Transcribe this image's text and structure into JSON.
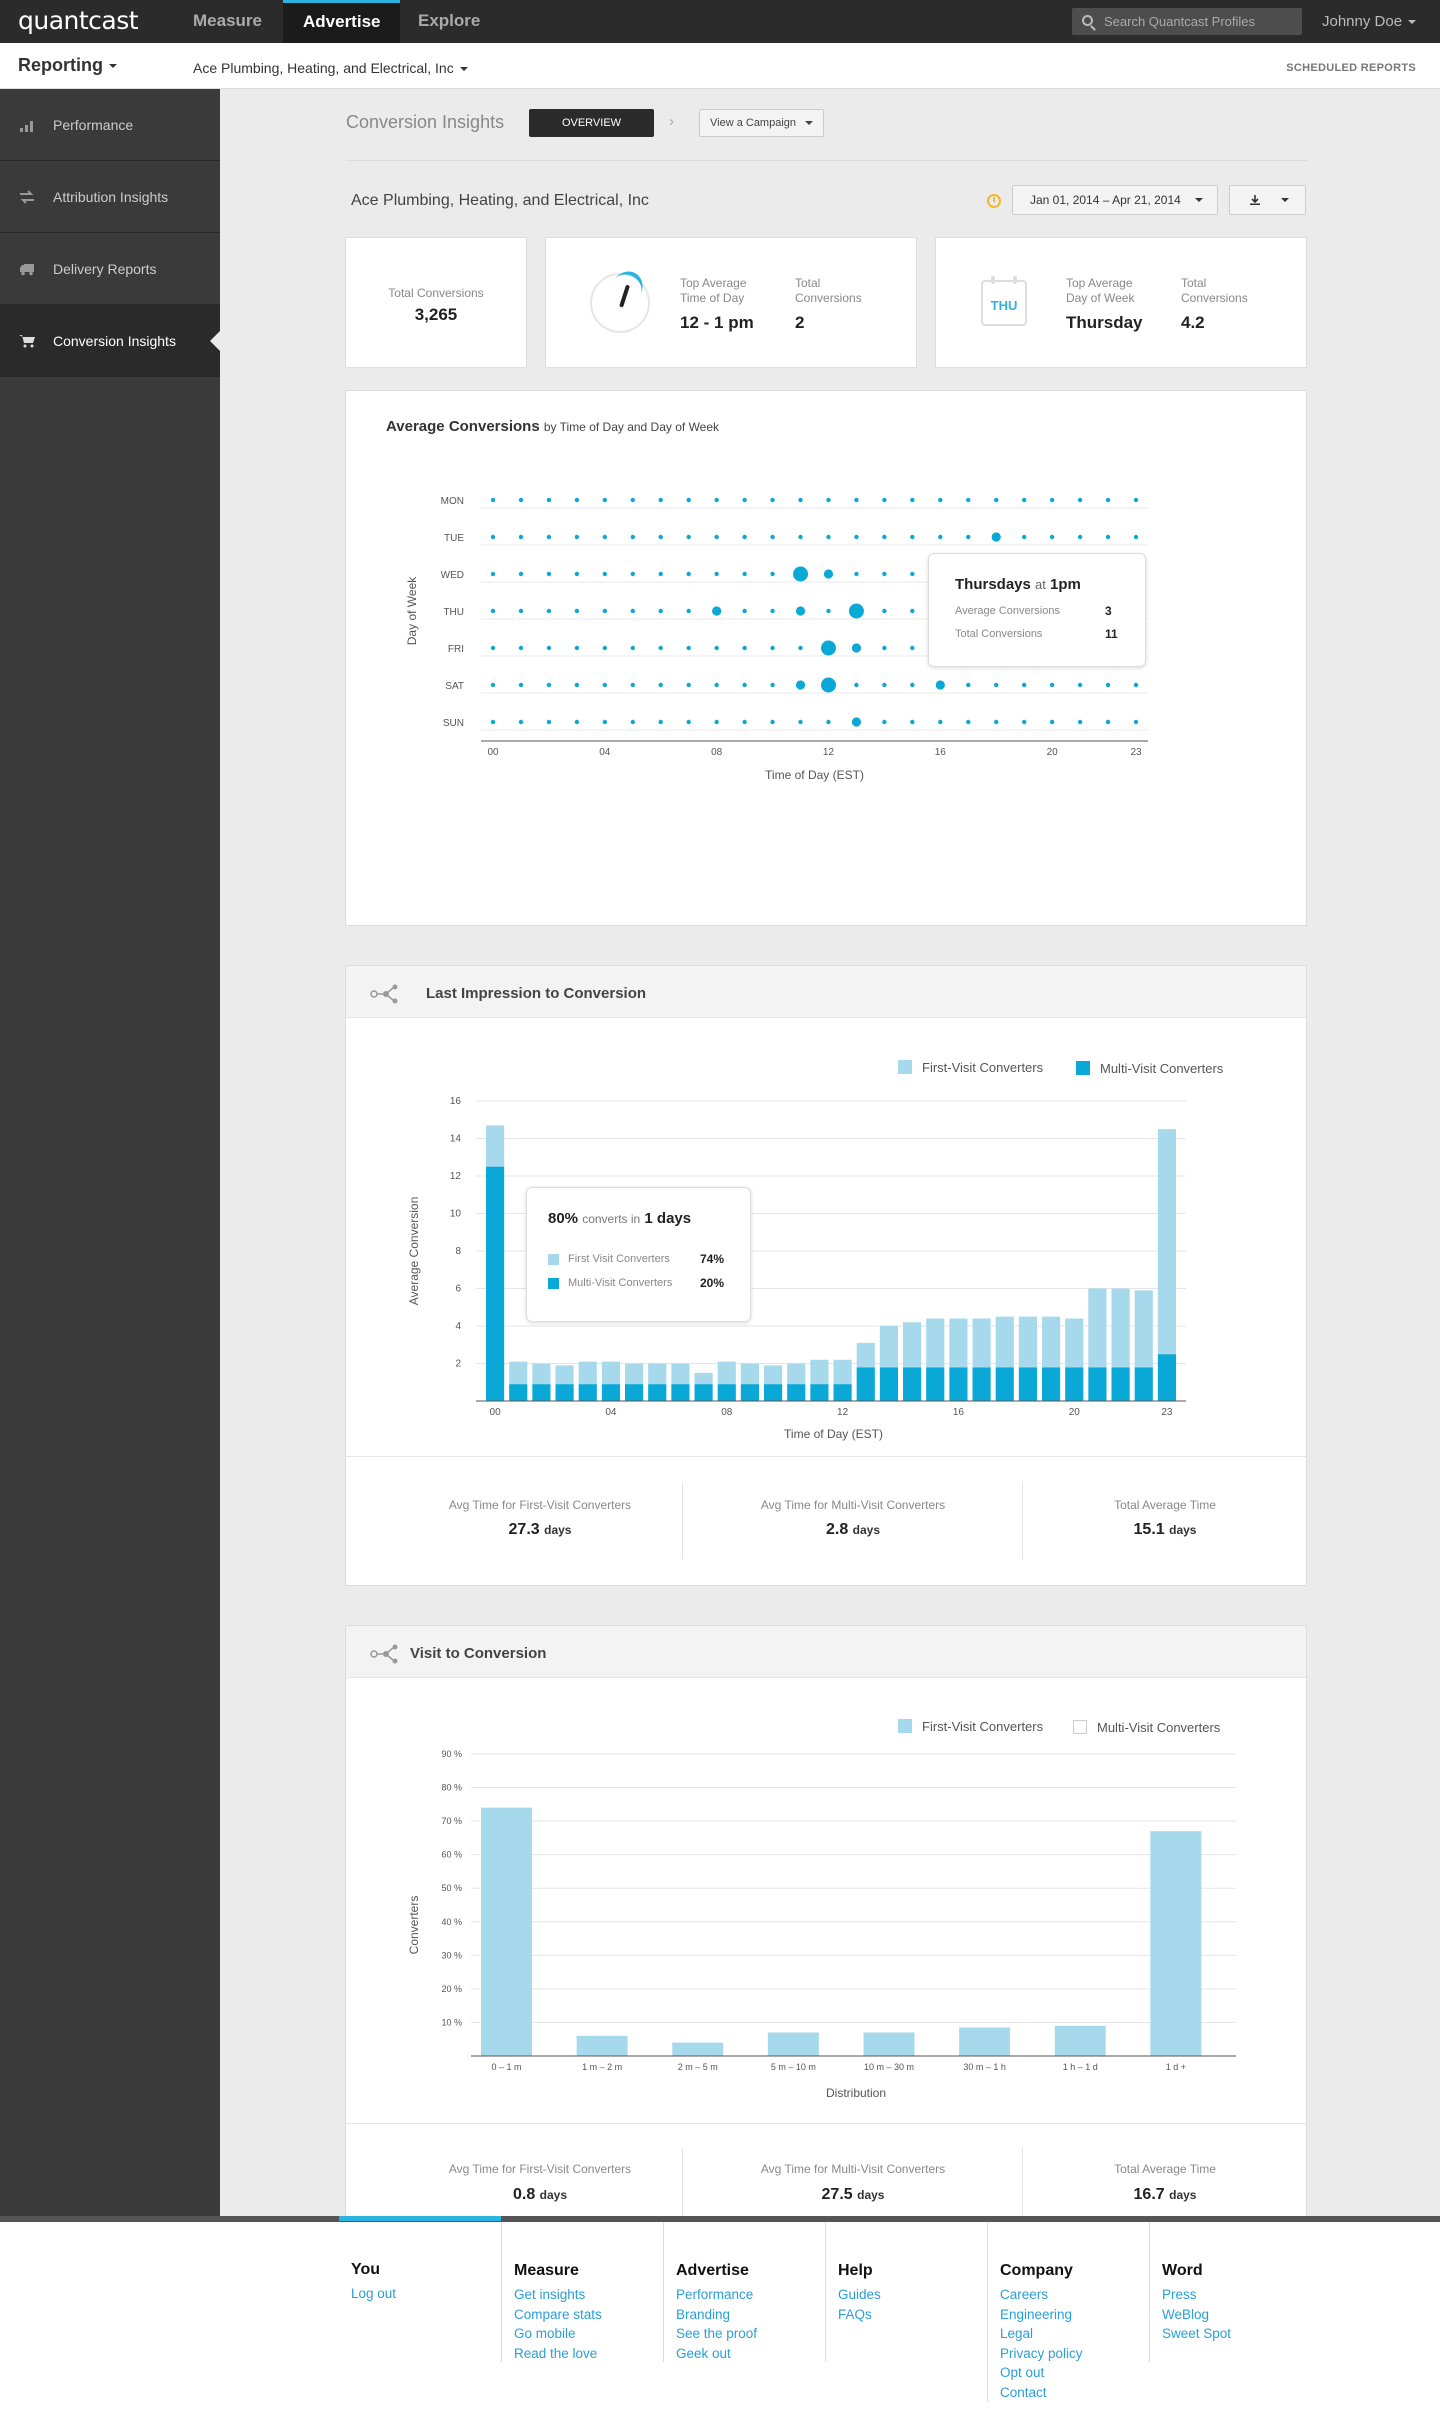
{
  "header": {
    "logo": "quantcast",
    "tabs": [
      {
        "label": "Measure",
        "active": false
      },
      {
        "label": "Advertise",
        "active": true
      },
      {
        "label": "Explore",
        "active": false
      }
    ],
    "search_placeholder": "Search Quantcast Profiles",
    "user": "Johnny Doe",
    "accent_color": "#2cb3e0"
  },
  "subheader": {
    "section": "Reporting",
    "company": "Ace Plumbing, Heating, and Electrical, Inc",
    "scheduled_reports": "SCHEDULED REPORTS"
  },
  "sidebar": {
    "items": [
      {
        "label": "Performance",
        "icon": "bar-chart-icon",
        "active": false
      },
      {
        "label": "Attribution Insights",
        "icon": "swap-arrows-icon",
        "active": false
      },
      {
        "label": "Delivery Reports",
        "icon": "truck-icon",
        "active": false
      },
      {
        "label": "Conversion Insights",
        "icon": "cart-icon",
        "active": true
      }
    ]
  },
  "page": {
    "title": "Conversion Insights",
    "overview_button": "OVERVIEW",
    "campaign_select": "View a Campaign",
    "company": "Ace Plumbing, Heating, and Electrical, Inc",
    "date_range": "Jan 01, 2014 – Apr 21, 2014"
  },
  "kpis": {
    "total_conversions_label": "Total Conversions",
    "total_conversions_value": "3,265",
    "top_time_label": "Top Average Time of Day",
    "top_time_value": "12 - 1 pm",
    "time_total_label": "Total Conversions",
    "time_total_value": "2",
    "calendar_day": "THU",
    "top_day_label": "Top Average Day of Week",
    "top_day_value": "Thursday",
    "day_total_label": "Total Conversions",
    "day_total_value": "4.2"
  },
  "avg_conversions": {
    "title": "Average Conversions",
    "subtitle": "by Time of Day and Day of Week",
    "tooltip": {
      "day": "Thursdays",
      "at": "at",
      "time": "1pm",
      "avg_label": "Average Conversions",
      "avg_value": "3",
      "total_label": "Total Conversions",
      "total_value": "11"
    }
  },
  "last_impression": {
    "title": "Last Impression to Conversion",
    "legend": [
      "First-Visit Converters",
      "Multi-Visit Converters"
    ],
    "tooltip": {
      "pct": "80%",
      "mid": "converts in",
      "days": "1 days",
      "first_label": "First Visit Converters",
      "first_value": "74%",
      "multi_label": "Multi-Visit Converters",
      "multi_value": "20%"
    },
    "stats": [
      {
        "label": "Avg Time for First-Visit Converters",
        "value": "27.3",
        "unit": "days"
      },
      {
        "label": "Avg Time for Multi-Visit Converters",
        "value": "2.8",
        "unit": "days"
      },
      {
        "label": "Total Average Time",
        "value": "15.1",
        "unit": "days"
      }
    ]
  },
  "visit_to_conversion": {
    "title": "Visit to Conversion",
    "legend": [
      "First-Visit Converters",
      "Multi-Visit Converters"
    ],
    "stats": [
      {
        "label": "Avg Time for First-Visit Converters",
        "value": "0.8",
        "unit": "days"
      },
      {
        "label": "Avg Time for Multi-Visit Converters",
        "value": "27.5",
        "unit": "days"
      },
      {
        "label": "Total Average Time",
        "value": "16.7",
        "unit": "days"
      }
    ]
  },
  "chart_data": [
    {
      "type": "scatter",
      "title": "Average Conversions",
      "subtitle": "by Time of Day and Day of Week",
      "xlabel": "Time of Day (EST)",
      "ylabel": "Day of Week",
      "days": [
        "MON",
        "TUE",
        "WED",
        "THU",
        "FRI",
        "SAT",
        "SUN"
      ],
      "x_ticks": [
        "00",
        "04",
        "08",
        "12",
        "16",
        "20",
        "23"
      ],
      "hours": 24,
      "base_size": 1,
      "highlights": [
        {
          "day": "TUE",
          "hour": 18,
          "size": 2
        },
        {
          "day": "WED",
          "hour": 11,
          "size": 3
        },
        {
          "day": "WED",
          "hour": 12,
          "size": 2
        },
        {
          "day": "THU",
          "hour": 8,
          "size": 2
        },
        {
          "day": "THU",
          "hour": 11,
          "size": 2
        },
        {
          "day": "THU",
          "hour": 13,
          "size": 3
        },
        {
          "day": "FRI",
          "hour": 12,
          "size": 3
        },
        {
          "day": "FRI",
          "hour": 13,
          "size": 2
        },
        {
          "day": "SAT",
          "hour": 11,
          "size": 2
        },
        {
          "day": "SAT",
          "hour": 12,
          "size": 3
        },
        {
          "day": "SAT",
          "hour": 16,
          "size": 2
        },
        {
          "day": "SUN",
          "hour": 13,
          "size": 2
        }
      ]
    },
    {
      "type": "bar",
      "stacked": true,
      "xlabel": "Time of Day (EST)",
      "ylabel": "Average Conversion",
      "ylim": [
        0,
        16
      ],
      "y_ticks": [
        2,
        4,
        6,
        8,
        10,
        12,
        14,
        16
      ],
      "x_ticks": [
        "00",
        "04",
        "08",
        "12",
        "16",
        "20",
        "23"
      ],
      "series": [
        {
          "name": "Multi-Visit Converters",
          "color": "#0aa8d6",
          "values": [
            12.5,
            0.9,
            0.9,
            0.9,
            0.9,
            0.9,
            0.9,
            0.9,
            0.9,
            0.9,
            0.9,
            0.9,
            0.9,
            0.9,
            0.9,
            0.9,
            1.8,
            1.8,
            1.8,
            1.8,
            1.8,
            1.8,
            1.8,
            1.8,
            1.8,
            1.8,
            1.8,
            1.8,
            1.8,
            2.5
          ]
        },
        {
          "name": "First-Visit Converters",
          "color": "#a7d9ec",
          "values": [
            2.2,
            1.2,
            1.1,
            1.0,
            1.2,
            1.2,
            1.1,
            1.1,
            1.1,
            0.6,
            1.2,
            1.1,
            1.0,
            1.1,
            1.3,
            1.3,
            1.3,
            2.2,
            2.4,
            2.6,
            2.6,
            2.6,
            2.7,
            2.7,
            2.7,
            2.6,
            4.2,
            4.2,
            4.1,
            12.0
          ]
        }
      ]
    },
    {
      "type": "bar",
      "xlabel": "Distribution",
      "ylabel": "Converters",
      "ylim": [
        0,
        90
      ],
      "y_ticks": [
        "10 %",
        "20 %",
        "30 %",
        "40 %",
        "50 %",
        "60 %",
        "70 %",
        "80 %",
        "90 %"
      ],
      "categories": [
        "0 – 1 m",
        "1 m – 2 m",
        "2 m – 5 m",
        "5 m – 10 m",
        "10 m – 30 m",
        "30 m – 1 h",
        "1 h – 1 d",
        "1 d +"
      ],
      "series": [
        {
          "name": "First-Visit Converters",
          "color": "#a7d9ec",
          "values": [
            74,
            6,
            4,
            7,
            7,
            8.5,
            9,
            67
          ]
        },
        {
          "name": "Multi-Visit Converters",
          "values": [
            0,
            0,
            0,
            0,
            0,
            0,
            0,
            0
          ]
        }
      ]
    }
  ],
  "footer": {
    "columns": [
      {
        "title": "You",
        "links": [
          "Log out"
        ]
      },
      {
        "title": "Measure",
        "links": [
          "Get insights",
          "Compare stats",
          "Go mobile",
          "Read the love"
        ]
      },
      {
        "title": "Advertise",
        "links": [
          "Performance",
          "Branding",
          "See the proof",
          "Geek out"
        ]
      },
      {
        "title": "Help",
        "links": [
          "Guides",
          "FAQs"
        ]
      },
      {
        "title": "Company",
        "links": [
          "Careers",
          "Engineering",
          "Legal",
          "Privacy policy",
          "Opt out",
          "Contact"
        ]
      },
      {
        "title": "Word",
        "links": [
          "Press",
          "WeBlog",
          "Sweet Spot"
        ]
      }
    ]
  }
}
